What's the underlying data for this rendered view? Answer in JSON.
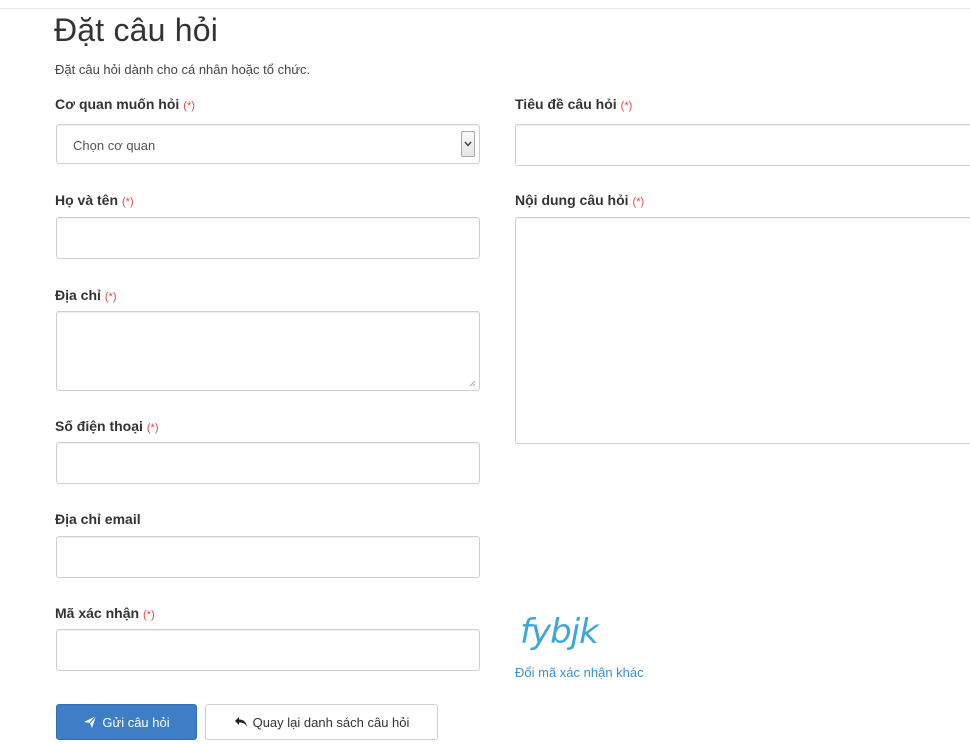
{
  "page": {
    "title": "Đặt câu hỏi",
    "subtitle": "Đặt câu hỏi dành cho cá nhân hoặc tổ chức.",
    "required_marker": "(*)"
  },
  "form": {
    "agency": {
      "label": "Cơ quan muốn hỏi",
      "selected": "Chọn cơ quan"
    },
    "full_name": {
      "label": "Họ và tên",
      "value": ""
    },
    "address": {
      "label": "Địa chỉ",
      "value": ""
    },
    "phone": {
      "label": "Số điện thoại",
      "value": ""
    },
    "email": {
      "label": "Địa chỉ email",
      "value": ""
    },
    "captcha_input": {
      "label": "Mã xác nhận",
      "value": ""
    },
    "question_title": {
      "label": "Tiêu đề câu hỏi",
      "value": ""
    },
    "question_content": {
      "label": "Nội dung câu hỏi",
      "value": ""
    }
  },
  "captcha": {
    "text": "fybjk",
    "refresh_label": "Đổi mã xác nhận khác"
  },
  "buttons": {
    "submit": {
      "label": "Gửi câu hỏi",
      "icon": "send-icon"
    },
    "back": {
      "label": "Quay lại danh sách câu hỏi",
      "icon": "reply-icon"
    }
  },
  "colors": {
    "primary": "#3d7ec6",
    "required": "#e04848",
    "captcha": "#3fa7d6",
    "link": "#3b8fd1"
  }
}
